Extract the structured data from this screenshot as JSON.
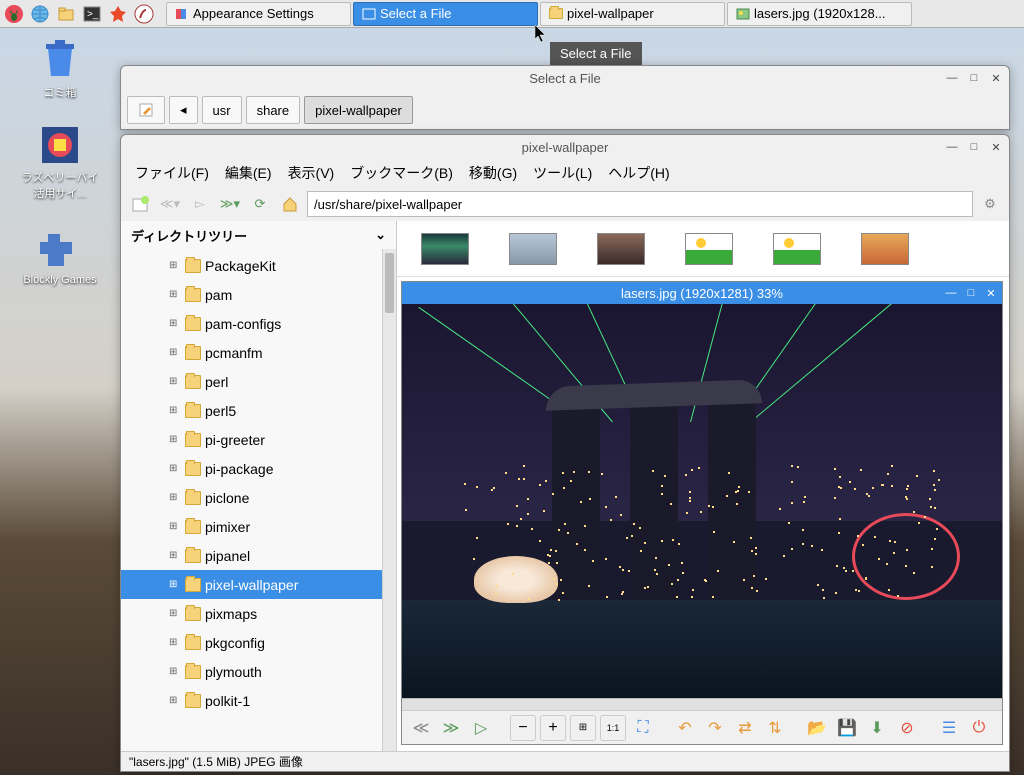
{
  "taskbar": {
    "buttons": [
      {
        "label": "Appearance Settings",
        "icon": "settings"
      },
      {
        "label": "Select a File",
        "icon": "window",
        "active": true
      },
      {
        "label": "pixel-wallpaper",
        "icon": "folder"
      },
      {
        "label": "lasers.jpg (1920x128...",
        "icon": "image"
      }
    ]
  },
  "tooltip": "Select a File",
  "desktop": {
    "trash": "ゴミ箱",
    "book": "ラズベリーパイ活用サイ...",
    "blockly": "Blockly Games"
  },
  "selectFile": {
    "title": "Select a File",
    "path": [
      "usr",
      "share",
      "pixel-wallpaper"
    ]
  },
  "fm": {
    "title": "pixel-wallpaper",
    "menu": [
      "ファイル(F)",
      "編集(E)",
      "表示(V)",
      "ブックマーク(B)",
      "移動(G)",
      "ツール(L)",
      "ヘルプ(H)"
    ],
    "address": "/usr/share/pixel-wallpaper",
    "tree_header": "ディレクトリツリー",
    "tree": [
      {
        "name": "PackageKit"
      },
      {
        "name": "pam"
      },
      {
        "name": "pam-configs"
      },
      {
        "name": "pcmanfm"
      },
      {
        "name": "perl"
      },
      {
        "name": "perl5"
      },
      {
        "name": "pi-greeter"
      },
      {
        "name": "pi-package"
      },
      {
        "name": "piclone"
      },
      {
        "name": "pimixer"
      },
      {
        "name": "pipanel"
      },
      {
        "name": "pixel-wallpaper",
        "selected": true
      },
      {
        "name": "pixmaps"
      },
      {
        "name": "pkgconfig"
      },
      {
        "name": "plymouth"
      },
      {
        "name": "polkit-1"
      }
    ]
  },
  "imageViewer": {
    "title": "lasers.jpg (1920x1281) 33%"
  },
  "status": "\"lasers.jpg\" (1.5 MiB) JPEG 画像"
}
